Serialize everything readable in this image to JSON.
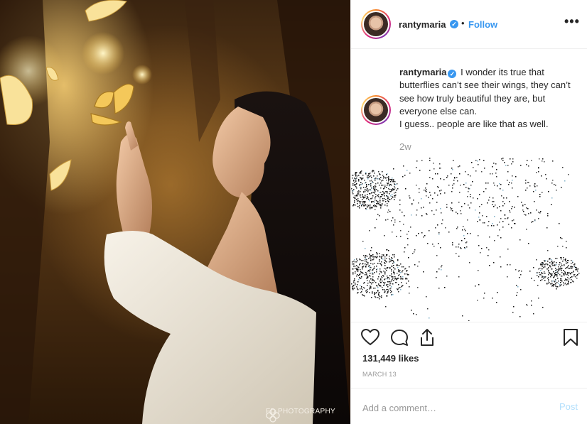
{
  "post": {
    "image_alt": "",
    "watermark": "FD PHOTOGRAPHY"
  },
  "header": {
    "username": "rantymaria",
    "verified": true,
    "separator": "•",
    "follow_label": "Follow",
    "more_icon": "more-horizontal-icon",
    "more_label": "•••"
  },
  "caption": {
    "username": "rantymaria",
    "text": "I wonder its true that butterflies can’t see their wings, they can’t see how truly beautiful they are, but everyone else can.",
    "text2": "I guess.. people are like that as well.",
    "time": "2w"
  },
  "actions": {
    "like_icon": "heart-icon",
    "comment_icon": "comment-icon",
    "share_icon": "share-icon",
    "save_icon": "bookmark-icon",
    "likes": "131,449 likes",
    "date": "MARCH 13"
  },
  "comment": {
    "placeholder": "Add a comment…",
    "post_label": "Post"
  },
  "colors": {
    "accent": "#3897f0",
    "post_disabled": "#b2dffc",
    "muted": "#999999",
    "divider": "#efefef"
  }
}
